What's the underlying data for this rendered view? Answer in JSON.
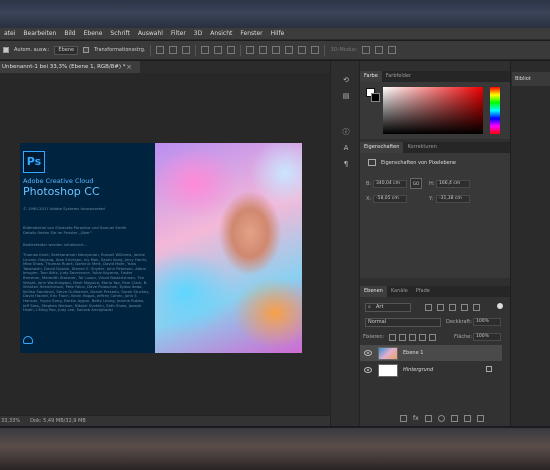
{
  "menu": [
    "atei",
    "Bearbeiten",
    "Bild",
    "Ebene",
    "Schrift",
    "Auswahl",
    "Filter",
    "3D",
    "Ansicht",
    "Fenster",
    "Hilfe"
  ],
  "options_bar": {
    "auto_select_label": "Autom. ausw.:",
    "auto_select_value": "Ebene",
    "transform_label": "Transformationsstrg.",
    "mode3d_label": "3D-Modus:"
  },
  "document": {
    "tab_title": "Unbenannt-1 bei 33,3% (Ebene 1, RGB/8#) *",
    "close_symbol": "×",
    "zoom": "33,33%",
    "doc_size": "Dok: 5,49 MB/32,9 MB"
  },
  "splash": {
    "brand": "Adobe Creative Cloud",
    "product": "Photoshop CC",
    "logo": "Ps",
    "copyright": "© 1990-2017 Adobe Systems Incorporated",
    "artwork_line": "Bildmaterial von Elizaveta Porodina und Samuel Smith",
    "legal_line": "Details finden Sie im Fenster „Über“",
    "status_line": "Bedienfelder werden initialisiert...",
    "credits": "Thomas Knoll, Seetharaman Narayanan, Russell Williams, Jackie Lincoln-Owyang, Alan Erickson, Ivy Mak, Sarah Kong, Jerry Harris, Mike Shaw, Thomas Ruark, Dominic Mert, David Mohr, Yuko Takahashi, David Dobish, Steven E. Snyder, John Peterson, Adam Jerugim, Tom Attix, Judy Severance, Yukie Koyama, Foster Brereton, Meredith Stotzner, Tai Luxon, Vinod Balakrishnan, Tim Wright, John Worthington, Mark Maguire, Maria Yap, Pam Clark, B. Winston Hendrickson, Pete Falco, Dave Polaschek, Kyoko Itoda, Kellisa Sandoval, Steve Guilhamet, Daniel Presedo, Sarah Stuckey, David Hackel, Eric Floch, Kevin Hopps, Jeffrey Cohen, John E. Hanson, Yuyan Song, Barkin Aygun, Betty Leong, Jeanne Rubbo, Jeff Sass, Stephen Nielson, Nikolai Svakhin, Seth Shaw, Joseph Hsieh, I-Ming Pao, Judy Lee, Sohrab Amirghodsi"
  },
  "right_panel": {
    "color_tabs": [
      "Farbe",
      "Farbfelder"
    ],
    "props_tabs": [
      "Eigenschaften",
      "Korrekturen"
    ],
    "props_title": "Eigenschaften von Pixelebene",
    "width_label": "B:",
    "width_value": "340,04 cm",
    "link_symbol": "GO",
    "height_label": "H:",
    "height_value": "166,4 cm",
    "x_label": "X:",
    "x_value": "-58,05 cm",
    "y_label": "Y:",
    "y_value": "-31,38 cm",
    "layers_tabs": [
      "Ebenen",
      "Kanäle",
      "Pfade"
    ],
    "filter_value": "Art",
    "blend_mode": "Normal",
    "opacity_label": "Deckkraft:",
    "opacity_value": "100%",
    "lock_label": "Fixieren:",
    "fill_label": "Fläche:",
    "fill_value": "100%",
    "layers": [
      "Ebene 1",
      "Hintergrund"
    ]
  },
  "far_right": {
    "library_tab": "Bibliot"
  },
  "colors": {
    "ps_blue": "#31a8ff",
    "panel_bg": "#383838",
    "menu_bg": "#3c3c3c"
  }
}
